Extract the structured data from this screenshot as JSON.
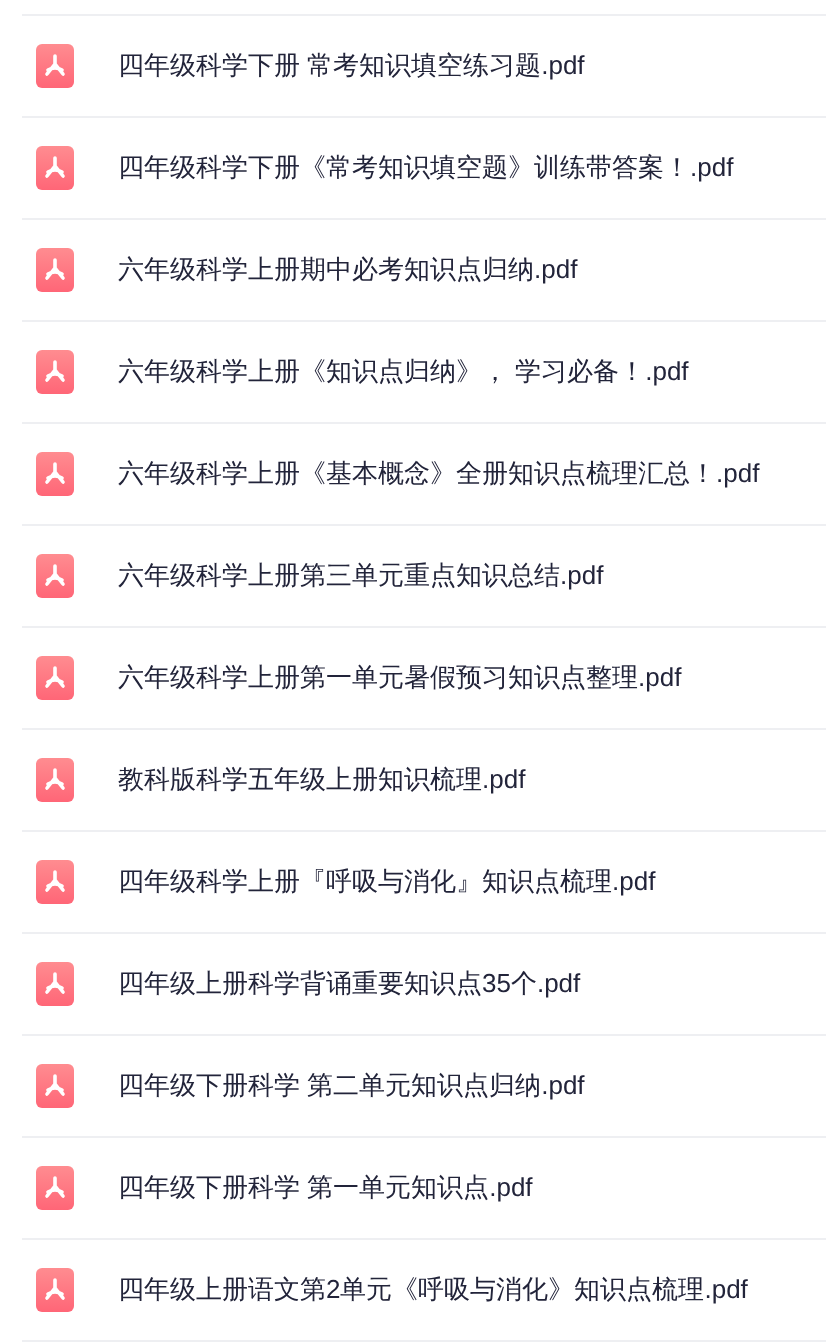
{
  "files": [
    {
      "name": "四年级科学下册 常考知识填空练习题.pdf",
      "kind": "pdf"
    },
    {
      "name": "四年级科学下册《常考知识填空题》训练带答案！.pdf",
      "kind": "pdf"
    },
    {
      "name": "六年级科学上册期中必考知识点归纳.pdf",
      "kind": "pdf"
    },
    {
      "name": "六年级科学上册《知识点归纳》， 学习必备！.pdf",
      "kind": "pdf"
    },
    {
      "name": "六年级科学上册《基本概念》全册知识点梳理汇总！.pdf",
      "kind": "pdf"
    },
    {
      "name": "六年级科学上册第三单元重点知识总结.pdf",
      "kind": "pdf"
    },
    {
      "name": "六年级科学上册第一单元暑假预习知识点整理.pdf",
      "kind": "pdf"
    },
    {
      "name": "教科版科学五年级上册知识梳理.pdf",
      "kind": "pdf"
    },
    {
      "name": "四年级科学上册『呼吸与消化』知识点梳理.pdf",
      "kind": "pdf"
    },
    {
      "name": "四年级上册科学背诵重要知识点35个.pdf",
      "kind": "pdf"
    },
    {
      "name": "四年级下册科学 第二单元知识点归纳.pdf",
      "kind": "pdf"
    },
    {
      "name": "四年级下册科学 第一单元知识点.pdf",
      "kind": "pdf"
    },
    {
      "name": "四年级上册语文第2单元《呼吸与消化》知识点梳理.pdf",
      "kind": "pdf"
    }
  ]
}
